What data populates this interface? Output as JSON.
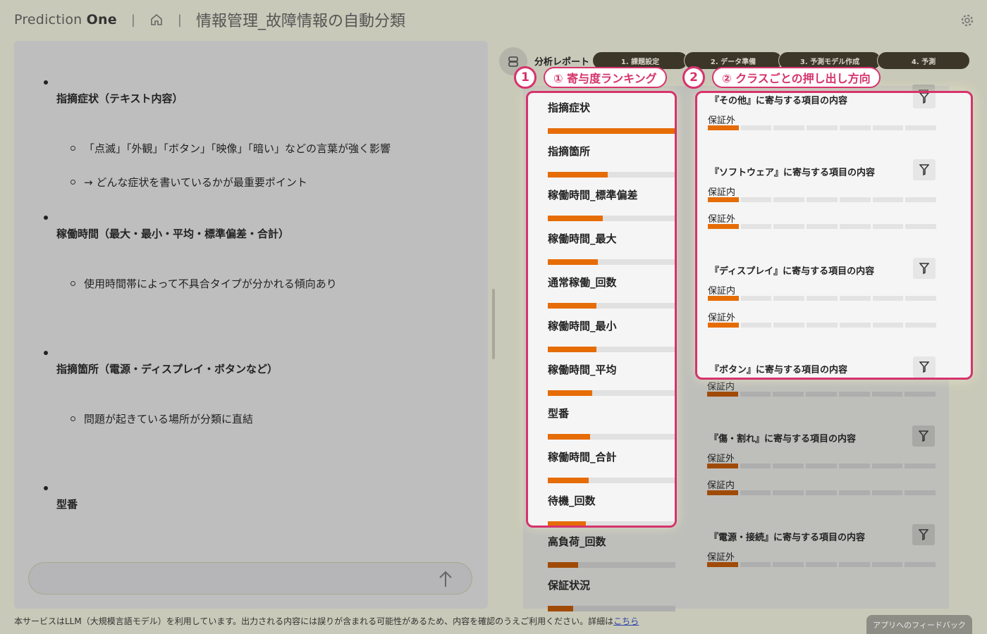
{
  "header": {
    "brand_light": "Prediction ",
    "brand_bold": "One",
    "sep1": "|",
    "sep2": "|",
    "title": "情報管理_故障情報の自動分類"
  },
  "chat": {
    "bullets": [
      {
        "title": "指摘症状（テキスト内容）",
        "items": [
          "「点滅」「外観」「ボタン」「映像」「暗い」などの言葉が強く影響",
          "→ どんな症状を書いているかが最重要ポイント"
        ]
      },
      {
        "title": "稼働時間（最大・最小・平均・標準偏差・合計）",
        "items": [
          "使用時間帯によって不具合タイプが分かれる傾向あり"
        ]
      },
      {
        "title": "指摘箇所（電源・ディスプレイ・ボタンなど）",
        "items": [
          "問題が起きている場所が分類に直結"
        ]
      },
      {
        "title": "型番",
        "items": []
      }
    ]
  },
  "footer": {
    "note": "本サービスはLLM（大規模言語モデル）を利用しています。出力される内容には誤りが含まれる可能性があるため、内容を確認のうえご利用ください。詳細は",
    "link": "こちら",
    "feedback": "アプリへのフィードバック"
  },
  "report": {
    "label": "分析レポート",
    "steps": [
      "1. 課題設定",
      "2. データ準備",
      "3. 予測モデル作成",
      "4. 予測"
    ],
    "annotation1_num": "1",
    "annotation1_label": "① 寄与度ランキング",
    "annotation2_num": "2",
    "annotation2_label": "② クラスごとの押し出し方向",
    "features": [
      {
        "name": "指摘症状",
        "value": 100
      },
      {
        "name": "指摘箇所",
        "value": 47
      },
      {
        "name": "稼働時間_標準偏差",
        "value": 43
      },
      {
        "name": "稼働時間_最大",
        "value": 39
      },
      {
        "name": "通常稼働_回数",
        "value": 38
      },
      {
        "name": "稼働時間_最小",
        "value": 38
      },
      {
        "name": "稼働時間_平均",
        "value": 35
      },
      {
        "name": "型番",
        "value": 33
      },
      {
        "name": "稼働時間_合計",
        "value": 32
      },
      {
        "name": "待機_回数",
        "value": 30
      },
      {
        "name": "高負荷_回数",
        "value": 24
      },
      {
        "name": "保証状況",
        "value": 20
      }
    ],
    "classes": [
      {
        "title": "『その他』に寄与する項目の内容",
        "rows": [
          {
            "label": "保証外",
            "level": 1
          }
        ]
      },
      {
        "title": "『ソフトウェア』に寄与する項目の内容",
        "rows": [
          {
            "label": "保証内",
            "level": 1
          },
          {
            "label": "保証外",
            "level": 1
          }
        ]
      },
      {
        "title": "『ディスプレイ』に寄与する項目の内容",
        "rows": [
          {
            "label": "保証内",
            "level": 1
          },
          {
            "label": "保証外",
            "level": 1
          }
        ]
      },
      {
        "title": "『ボタン』に寄与する項目の内容",
        "rows": [
          {
            "label": "保証内",
            "level": 1
          }
        ]
      },
      {
        "title": "『傷・割れ』に寄与する項目の内容",
        "rows": [
          {
            "label": "保証外",
            "level": 1
          },
          {
            "label": "保証内",
            "level": 1
          }
        ]
      },
      {
        "title": "『電源・接続』に寄与する項目の内容",
        "rows": [
          {
            "label": "保証外",
            "level": 1
          }
        ]
      }
    ]
  },
  "colors": {
    "accent_pink": "#d6336c",
    "bar_orange": "#e66c06",
    "bar_dim": "#a04a07"
  }
}
